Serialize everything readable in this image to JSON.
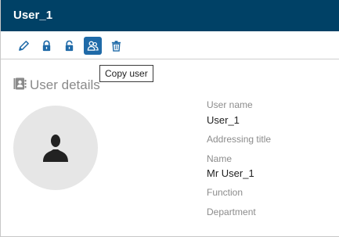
{
  "header": {
    "title": "User_1"
  },
  "toolbar": {
    "buttons": [
      {
        "name": "edit",
        "icon": "pencil-icon"
      },
      {
        "name": "lock",
        "icon": "lock-icon"
      },
      {
        "name": "unlock",
        "icon": "unlock-icon"
      },
      {
        "name": "copy-user",
        "icon": "users-icon",
        "active": true
      },
      {
        "name": "delete",
        "icon": "trash-icon"
      }
    ],
    "tooltip": "Copy user"
  },
  "section": {
    "title": "User details",
    "icon": "address-book-icon"
  },
  "avatar": {
    "icon": "user-silhouette-icon"
  },
  "fields": {
    "user_name_label": "User name",
    "user_name_value": "User_1",
    "addressing_title_label": "Addressing title",
    "name_label": "Name",
    "name_value": "Mr User_1",
    "function_label": "Function",
    "department_label": "Department"
  },
  "colors": {
    "header_bg": "#004166",
    "accent": "#1f6aa8",
    "icon_blue": "#1f6aa8"
  }
}
